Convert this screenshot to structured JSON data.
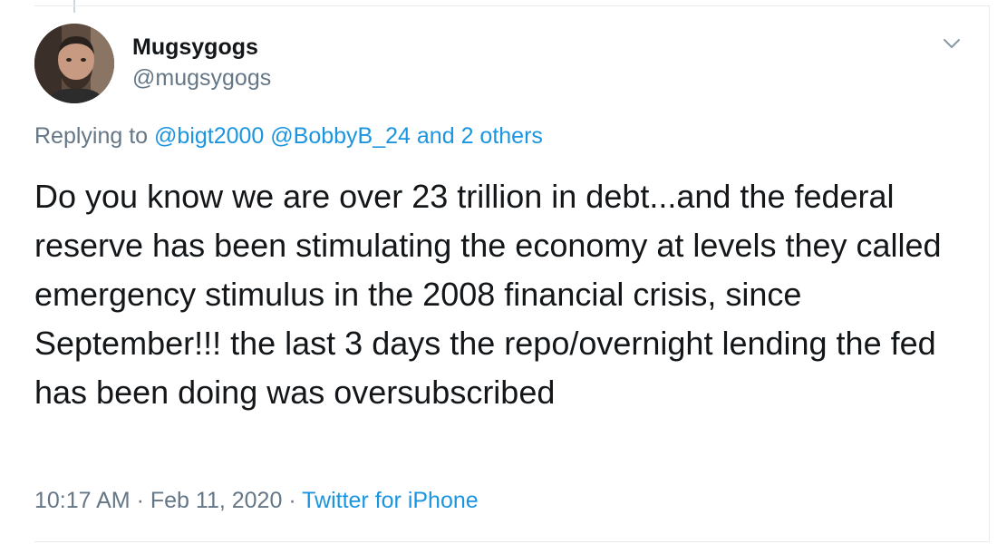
{
  "author": {
    "name": "Mugsygogs",
    "handle": "@mugsygogs"
  },
  "reply": {
    "prefix": "Replying to",
    "mention1": "@bigt2000",
    "mention2": "@BobbyB_24",
    "others": "and 2 others"
  },
  "tweet": {
    "text": "Do you know we are over 23 trillion in debt...and the federal reserve has been stimulating the economy at levels they called emergency stimulus in the 2008 financial crisis, since September!!! the last 3 days the repo/overnight lending the fed has been doing was oversubscribed"
  },
  "meta": {
    "time": "10:17 AM",
    "separator1": "·",
    "date": "Feb 11, 2020",
    "separator2": "·",
    "source": "Twitter for iPhone"
  },
  "icons": {
    "menu": "chevron-down-icon",
    "avatar": "profile-avatar"
  },
  "colors": {
    "link": "#1b95e0",
    "secondary_text": "#657786",
    "primary_text": "#14171a",
    "border": "#e6ecf0"
  }
}
